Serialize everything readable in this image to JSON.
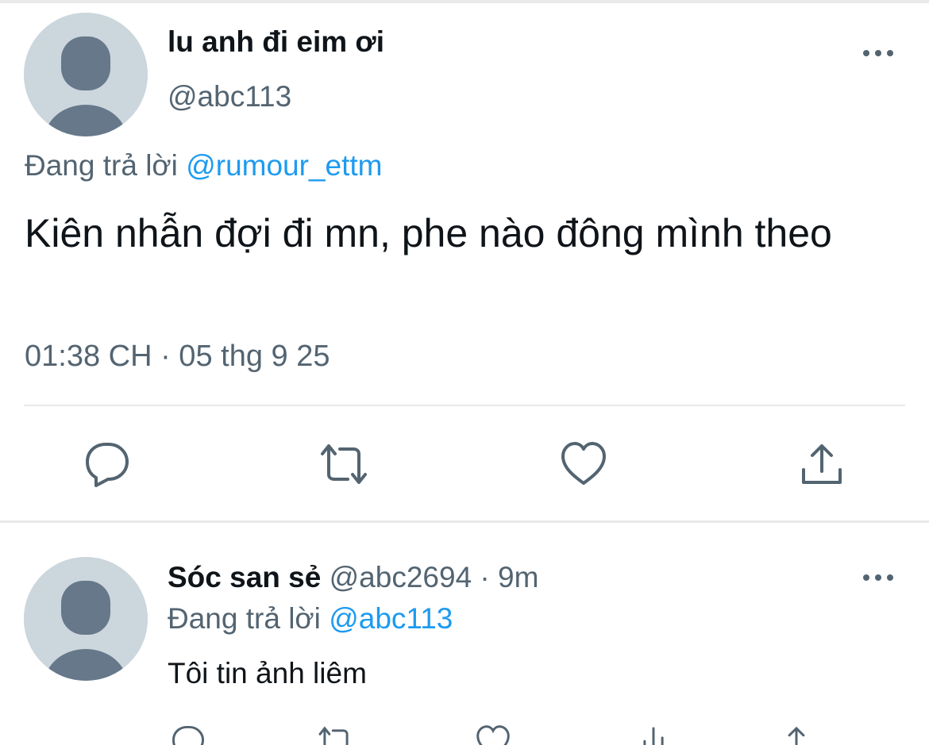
{
  "main_tweet": {
    "display_name": "lu anh đi eim ơi",
    "handle": "@abc113",
    "reply_prefix": "Đang trả lời",
    "reply_to": "@rumour_ettm",
    "text": "Kiên nhẫn đợi đi mn, phe nào đông mình theo",
    "timestamp": "01:38 CH · 05 thg 9 25"
  },
  "actions": {
    "reply_icon": "reply-icon",
    "retweet_icon": "retweet-icon",
    "like_icon": "heart-icon",
    "share_icon": "share-icon"
  },
  "reply_tweet": {
    "display_name": "Sóc san sẻ",
    "handle_time": "@abc2694 · 9m",
    "reply_prefix": "Đang trả lời",
    "reply_to": "@abc113",
    "text": "Tôi tin ảnh liêm"
  },
  "colors": {
    "text_primary": "#0f1419",
    "text_secondary": "#536471",
    "accent": "#1d9bf0",
    "divider": "#e7e9eb",
    "avatar_bg": "#ccd6dd",
    "avatar_fg": "#66788a"
  }
}
